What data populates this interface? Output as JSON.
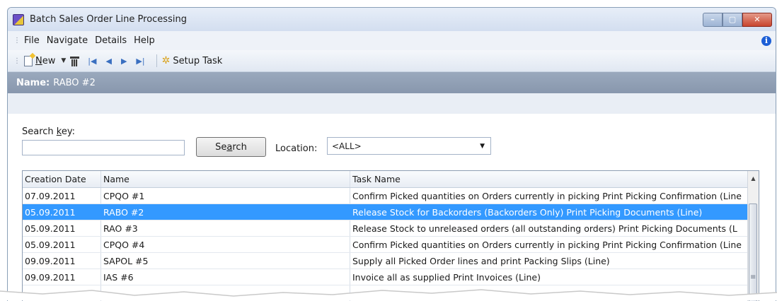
{
  "window": {
    "title": "Batch Sales Order Line Processing",
    "controls": {
      "minimize": "–",
      "maximize": "▢",
      "close": "✕"
    }
  },
  "menu": {
    "items": [
      "File",
      "Navigate",
      "Details",
      "Help"
    ],
    "info_icon": "i"
  },
  "toolbar": {
    "new_label_first": "N",
    "new_label_rest": "ew",
    "setup_task_label": "Setup Task",
    "icons": [
      "new-icon",
      "dropdown-arrow-icon",
      "delete-icon",
      "first-record-icon",
      "previous-record-icon",
      "next-record-icon",
      "last-record-icon",
      "setup-task-icon"
    ]
  },
  "name_bar": {
    "label": "Name:",
    "value": "RABO #2"
  },
  "search": {
    "label_pre": "Search ",
    "label_k": "k",
    "label_post": "ey:",
    "value": "",
    "button_pre": "Se",
    "button_a": "a",
    "button_post": "rch"
  },
  "location": {
    "label": "Location:",
    "selected": "<ALL>"
  },
  "grid": {
    "columns": [
      "Creation Date",
      "Name",
      "Task Name"
    ],
    "rows": [
      {
        "date": "07.09.2011",
        "name": "CPQO #1",
        "task": "Confirm Picked quantities on Orders currently in picking Print Picking Confirmation (Line"
      },
      {
        "date": "05.09.2011",
        "name": "RABO #2",
        "task": "Release Stock for Backorders (Backorders Only) Print Picking Documents (Line)"
      },
      {
        "date": "05.09.2011",
        "name": "RAO #3",
        "task": "Release Stock to unreleased orders (all outstanding orders) Print Picking Documents (L"
      },
      {
        "date": "05.09.2011",
        "name": "CPQO #4",
        "task": "Confirm Picked quantities on Orders currently in picking Print Picking Confirmation (Line"
      },
      {
        "date": "09.09.2011",
        "name": "SAPOL #5",
        "task": "Supply all Picked Order lines and print Packing Slips (Line)"
      },
      {
        "date": "09.09.2011",
        "name": "IAS #6",
        "task": "Invoice all as supplied Print Invoices (Line)"
      },
      {
        "date": "",
        "name": "",
        "task": ""
      }
    ],
    "selected_index": 1
  },
  "colors": {
    "selection": "#3399ff",
    "name_bar": "#8f9eb3",
    "close_button": "#c8452e"
  }
}
